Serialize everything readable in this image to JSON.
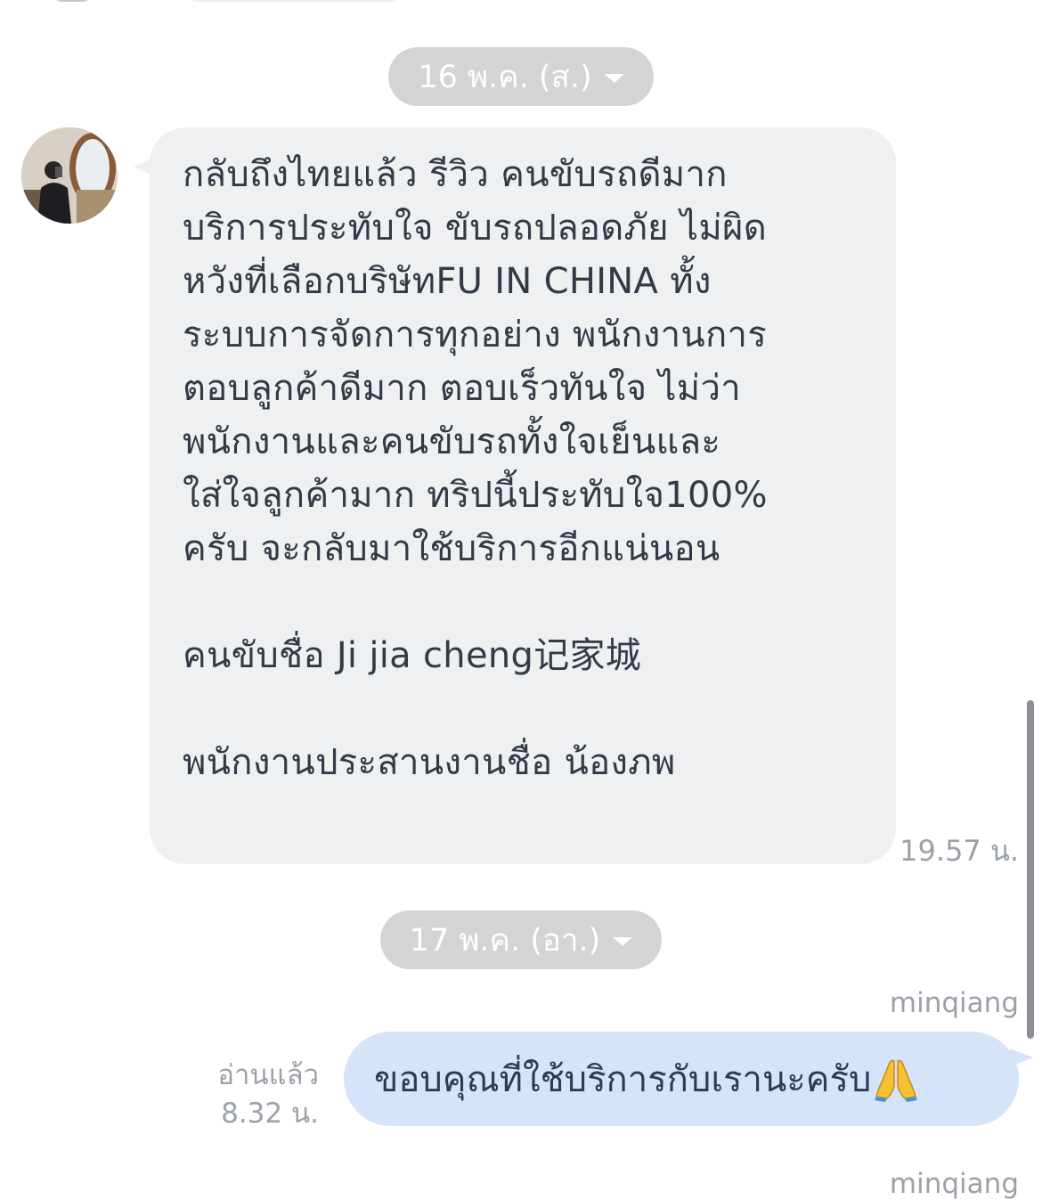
{
  "chat": {
    "date_separators": [
      {
        "label": "16 พ.ค. (ส.)"
      },
      {
        "label": "17 พ.ค. (อา.)"
      }
    ],
    "incoming_message": {
      "text": "กลับถึงไทยแล้ว รีวิว คนขับรถดีมาก\nบริการประทับใจ ขับรถปลอดภัย ไม่ผิด\nหวังที่เลือกบริษัทFU IN CHINA ทั้ง\nระบบการจัดการทุกอย่าง พนักงานการ\nตอบลูกค้าดีมาก ตอบเร็วทันใจ ไม่ว่า\nพนักงานและคนขับรถทั้งใจเย็นและ\nใส่ใจลูกค้ามาก ทริปนี้ประทับใจ100%\nครับ จะกลับมาใช้บริการอีกแน่นอน\n\nคนขับชื่อ Ji jia cheng记家城\n\nพนักงานประสานงานชื่อ น้องภพ",
      "time": "19.57 น."
    },
    "outgoing_message": {
      "sender": "minqiang",
      "text": "ขอบคุณที่ใช้บริการกับเรานะครับ",
      "emoji_icon": "folded-hands-icon",
      "read_label": "อ่านแล้ว",
      "time": "8.32 น."
    },
    "next_sender": "minqiang"
  },
  "colors": {
    "incoming_bubble": "#eff0f2",
    "outgoing_bubble": "#d6e4fa",
    "date_pill": "#d3d4d6",
    "meta_text": "#9ba1a8"
  }
}
